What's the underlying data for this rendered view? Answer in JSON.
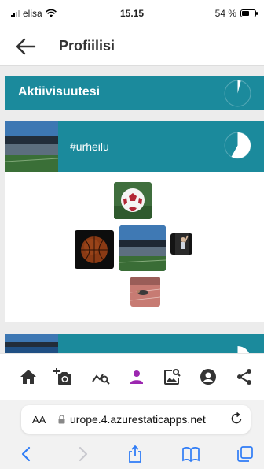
{
  "status": {
    "carrier": "elisa",
    "time": "15.15",
    "battery": "54 %",
    "battery_level": 0.54
  },
  "header": {
    "title": "Profiilisi"
  },
  "activity": {
    "title": "Aktiivisuutesi",
    "pie_fraction": 0.04
  },
  "sport": {
    "tag": "#urheilu",
    "pie_fraction": 0.58
  },
  "next": {
    "pie_fraction": 0.5
  },
  "bottom_nav": {
    "icons": [
      "home-icon",
      "add-photo-icon",
      "stats-icon",
      "person-icon",
      "image-search-icon",
      "account-icon",
      "share-icon"
    ],
    "active": "person-icon",
    "accent": "#9c27b0"
  },
  "browser": {
    "aa_label": "AA",
    "url": "urope.4.azurestaticapps.net"
  },
  "colors": {
    "teal": "#1b8a9c",
    "safari_blue": "#2f7cf6"
  }
}
